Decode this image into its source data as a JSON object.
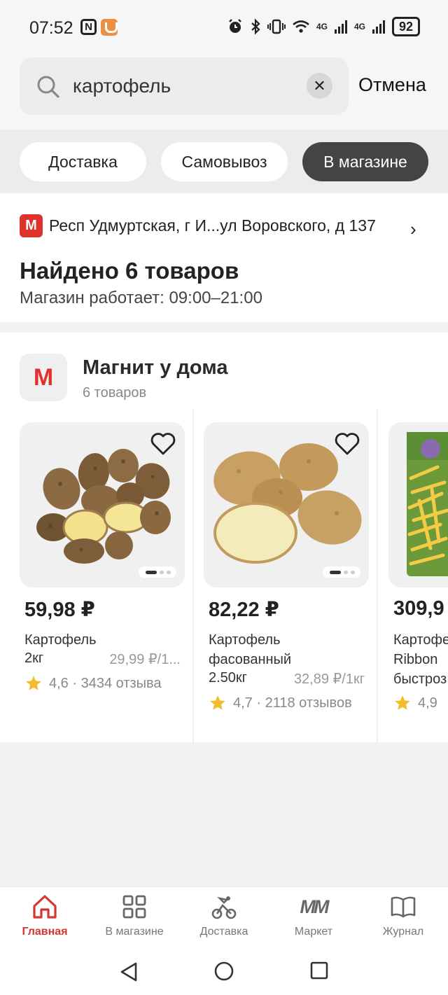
{
  "status_bar": {
    "time": "07:52",
    "nfc_glyph": "N",
    "network_labels": [
      "4G",
      "4G"
    ],
    "battery": "92"
  },
  "search": {
    "query": "картофель",
    "placeholder": "",
    "cancel_label": "Отмена"
  },
  "tabs": [
    {
      "label": "Доставка",
      "active": false
    },
    {
      "label": "Самовывоз",
      "active": false
    },
    {
      "label": "В магазине",
      "active": true
    }
  ],
  "store": {
    "brand_badge": "М",
    "address": "Респ Удмуртская, г И...ул Воровского, д 137",
    "found_text": "Найдено 6 товаров",
    "hours_text": "Магазин работает: 09:00–21:00"
  },
  "shop": {
    "logo_letter": "М",
    "name": "Магнит у дома",
    "count": "6 товаров",
    "products": [
      {
        "price": "59,98 ₽",
        "title_lines": [
          "Картофель"
        ],
        "weight": "2кг",
        "unit_price": "29,99 ₽/1...",
        "rating": "4,6",
        "reviews": "3434 отзыва"
      },
      {
        "price": "82,22 ₽",
        "title_lines": [
          "Картофель",
          "фасованный"
        ],
        "weight": "2.50кг",
        "unit_price": "32,89 ₽/1кг",
        "rating": "4,7",
        "reviews": "2118 отзывов"
      },
      {
        "price": "309,9",
        "title_lines": [
          "Картофе",
          "Ribbon",
          "быстроз"
        ],
        "weight": "",
        "unit_price": "",
        "rating": "4,9",
        "reviews": ""
      }
    ]
  },
  "bottom_nav": [
    {
      "label": "Главная",
      "icon": "home-icon",
      "active": true
    },
    {
      "label": "В магазине",
      "icon": "grid-icon",
      "active": false
    },
    {
      "label": "Доставка",
      "icon": "bike-delivery-icon",
      "active": false
    },
    {
      "label": "Маркет",
      "icon": "market-logo-icon",
      "active": false,
      "glyph": "ММ"
    },
    {
      "label": "Журнал",
      "icon": "book-icon",
      "active": false
    }
  ],
  "colors": {
    "brand_red": "#e0322c",
    "active_tab": "#444444",
    "nav_active": "#d43631",
    "star": "#f2bd2c"
  }
}
